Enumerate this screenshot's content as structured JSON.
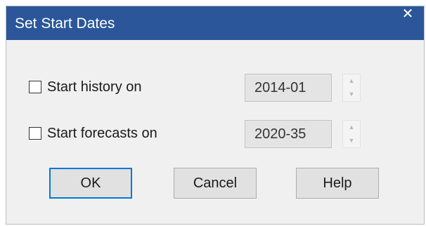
{
  "window": {
    "title": "Set Start Dates",
    "close_glyph": "✕",
    "title_bar_color": "#2b579a"
  },
  "rows": [
    {
      "label": "Start history on",
      "checked": false,
      "value": "2014-01",
      "spin_up": "▲",
      "spin_down": "▼"
    },
    {
      "label": "Start forecasts on",
      "checked": false,
      "value": "2020-35",
      "spin_up": "▲",
      "spin_down": "▼"
    }
  ],
  "buttons": {
    "ok": "OK",
    "cancel": "Cancel",
    "help": "Help"
  },
  "icons": {
    "close": "close-icon",
    "spin_up": "chevron-up-icon",
    "spin_down": "chevron-down-icon"
  }
}
